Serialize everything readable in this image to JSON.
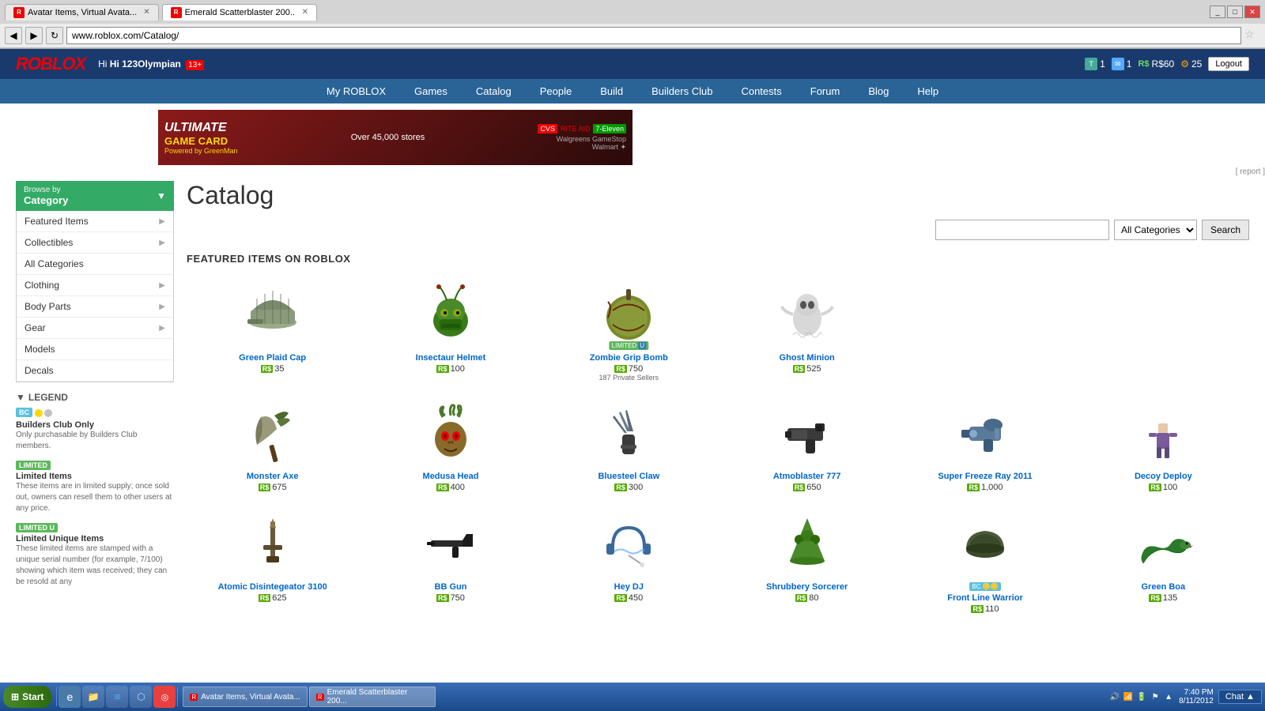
{
  "browser": {
    "tabs": [
      {
        "label": "Avatar Items, Virtual Avata...",
        "favicon": "R",
        "active": false
      },
      {
        "label": "Emerald Scatterblaster 200...",
        "favicon": "R",
        "active": true
      },
      {
        "label": "",
        "favicon": "",
        "active": false
      }
    ],
    "address": "www.roblox.com/Catalog/",
    "window_controls": [
      "_",
      "□",
      "✕"
    ]
  },
  "header": {
    "logo": "ROBLOX",
    "greeting": "Hi 123Olympian",
    "age": "13+",
    "tickets": "1",
    "messages": "1",
    "robux": "R$60",
    "gear_count": "25",
    "logout": "Logout"
  },
  "nav": {
    "items": [
      "My ROBLOX",
      "Games",
      "Catalog",
      "People",
      "Build",
      "Builders Club",
      "Contests",
      "Forum",
      "Blog",
      "Help"
    ]
  },
  "search": {
    "placeholder": "",
    "category": "All Categories",
    "button": "Search"
  },
  "page": {
    "title": "Catalog",
    "section_title": "FEATURED ITEMS ON ROBLOX"
  },
  "sidebar": {
    "header": "Browse by Category",
    "items": [
      {
        "label": "Featured Items",
        "has_arrow": true
      },
      {
        "label": "Collectibles",
        "has_arrow": true
      },
      {
        "label": "All Categories",
        "has_arrow": false
      },
      {
        "label": "Clothing",
        "has_arrow": true
      },
      {
        "label": "Body Parts",
        "has_arrow": true
      },
      {
        "label": "Gear",
        "has_arrow": true
      },
      {
        "label": "Models",
        "has_arrow": false
      },
      {
        "label": "Decals",
        "has_arrow": false
      }
    ],
    "legend": {
      "title": "LEGEND",
      "items": [
        {
          "badge": "BC",
          "badge_type": "bc",
          "extra_badge": "coins",
          "label": "Builders Club Only",
          "desc": "Only purchasable by Builders Club members."
        },
        {
          "badge": "LIMITED",
          "badge_type": "limited",
          "label": "Limited Items",
          "desc": "These items are in limited supply; once sold out, owners can resell them to other users at any price."
        },
        {
          "badge": "LIMITED U",
          "badge_type": "limited-u",
          "label": "Limited Unique Items",
          "desc": "These limited items are stamped with a unique serial number (for example, 7/100) showing which item was received; they can be resold at any"
        }
      ]
    }
  },
  "items": [
    {
      "name": "Green Plaid Cap",
      "price": "35",
      "currency": "R$",
      "limited": false,
      "bc_only": false,
      "private_sellers": "",
      "color": "#7a9a5a",
      "shape": "cap"
    },
    {
      "name": "Insectaur Helmet",
      "price": "100",
      "currency": "R$",
      "limited": false,
      "bc_only": false,
      "private_sellers": "",
      "color": "#4a8a2a",
      "shape": "helmet"
    },
    {
      "name": "Zombie Grip Bomb",
      "price": "750",
      "currency": "R$",
      "limited": true,
      "limited_u": false,
      "bc_only": false,
      "private_sellers": "187 Private Sellers",
      "color": "#8a8a2a",
      "shape": "bomb"
    },
    {
      "name": "Ghost Minion",
      "price": "525",
      "currency": "R$",
      "limited": false,
      "bc_only": false,
      "private_sellers": "",
      "color": "#aaaaaa",
      "shape": "ghost"
    },
    {
      "name": "",
      "price": "",
      "empty": true
    },
    {
      "name": "",
      "price": "",
      "empty": true
    },
    {
      "name": "Monster Axe",
      "price": "675",
      "currency": "R$",
      "limited": false,
      "bc_only": false,
      "private_sellers": "",
      "color": "#6a5a2a",
      "shape": "axe"
    },
    {
      "name": "Medusa Head",
      "price": "400",
      "currency": "R$",
      "limited": false,
      "bc_only": false,
      "private_sellers": "",
      "color": "#8a6a2a",
      "shape": "head"
    },
    {
      "name": "Bluesteel Claw",
      "price": "300",
      "currency": "R$",
      "limited": false,
      "bc_only": false,
      "private_sellers": "",
      "color": "#4a6a8a",
      "shape": "claw"
    },
    {
      "name": "Atmoblaster 777",
      "price": "650",
      "currency": "R$",
      "limited": false,
      "bc_only": false,
      "private_sellers": "",
      "color": "#3a3a3a",
      "shape": "gun"
    },
    {
      "name": "Super Freeze Ray 2011",
      "price": "1,000",
      "currency": "R$",
      "limited": false,
      "bc_only": false,
      "private_sellers": "",
      "color": "#5a7a9a",
      "shape": "raygun"
    },
    {
      "name": "Decoy Deploy",
      "price": "100",
      "currency": "R$",
      "limited": false,
      "bc_only": false,
      "private_sellers": "",
      "color": "#7a5a9a",
      "shape": "figure"
    },
    {
      "name": "Atomic Disintegeator 3100",
      "price": "625",
      "currency": "R$",
      "limited": false,
      "bc_only": false,
      "private_sellers": "",
      "color": "#5a3a2a",
      "shape": "weapon"
    },
    {
      "name": "BB Gun",
      "price": "750",
      "currency": "R$",
      "limited": false,
      "bc_only": false,
      "private_sellers": "",
      "color": "#333",
      "shape": "rifle"
    },
    {
      "name": "Hey DJ",
      "price": "450",
      "currency": "R$",
      "limited": false,
      "bc_only": false,
      "private_sellers": "",
      "color": "#3a6a9a",
      "shape": "headphones"
    },
    {
      "name": "Shrubbery Sorcerer",
      "price": "80",
      "currency": "R$",
      "limited": false,
      "bc_only": false,
      "private_sellers": "",
      "color": "#4a8a2a",
      "shape": "hat"
    },
    {
      "name": "Front Line Warrior",
      "price": "110",
      "currency": "R$",
      "limited": false,
      "bc_only": true,
      "private_sellers": "",
      "color": "#2a4a2a",
      "shape": "helmet2"
    },
    {
      "name": "Green Boa",
      "price": "135",
      "currency": "R$",
      "limited": false,
      "bc_only": false,
      "private_sellers": "",
      "color": "#2a7a2a",
      "shape": "boa"
    }
  ],
  "taskbar": {
    "start_label": "Start",
    "windows": [
      {
        "label": "Avatar Items, Virtual Avata...",
        "active": false
      },
      {
        "label": "Emerald Scatterblaster 200...",
        "active": true
      }
    ],
    "time": "7:40 PM",
    "date": "8/11/2012",
    "chat": "Chat"
  }
}
